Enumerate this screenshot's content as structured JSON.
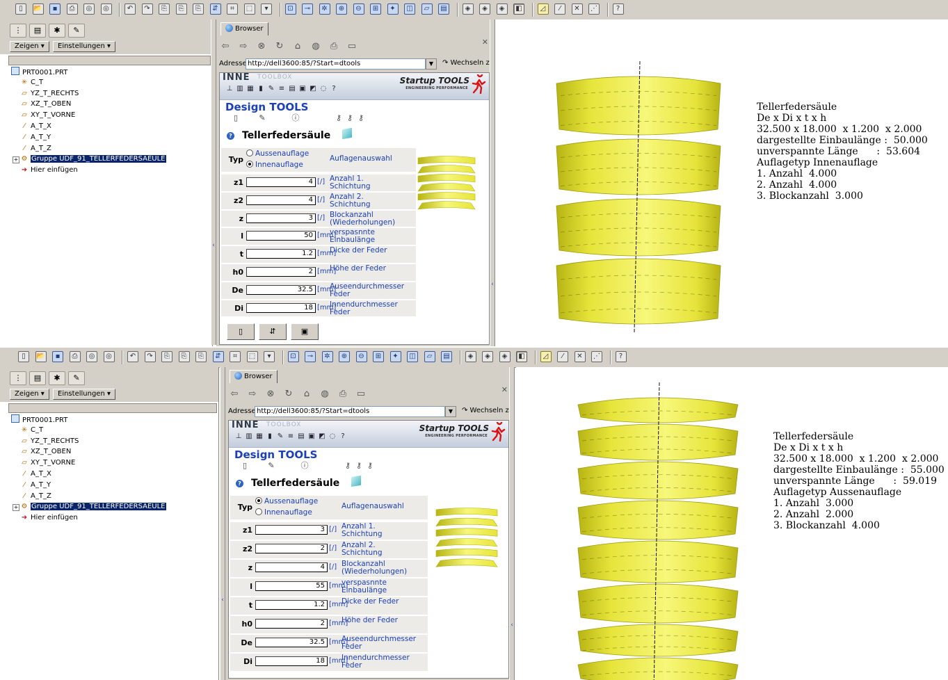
{
  "colors": {
    "spring_light": "#f7f77a",
    "spring_mid": "#e6e43a",
    "spring_dark": "#b7b414",
    "title_blue": "#1b3fb7",
    "selected": "#0a246a"
  },
  "instances": [
    {
      "tree": {
        "menu_show": "Zeigen",
        "menu_settings": "Einstellungen",
        "items": [
          {
            "label": "PRT0001.PRT",
            "icon": "part-icon"
          },
          {
            "label": "C_T",
            "icon": "csys-icon"
          },
          {
            "label": "YZ_T_RECHTS",
            "icon": "datum-plane-icon"
          },
          {
            "label": "XZ_T_OBEN",
            "icon": "datum-plane-icon"
          },
          {
            "label": "XY_T_VORNE",
            "icon": "datum-plane-icon"
          },
          {
            "label": "A_T_X",
            "icon": "datum-axis-icon"
          },
          {
            "label": "A_T_Y",
            "icon": "datum-axis-icon"
          },
          {
            "label": "A_T_Z",
            "icon": "datum-axis-icon"
          },
          {
            "label": "Gruppe UDF_91_TELLERFEDERSAEULE",
            "icon": "group-icon"
          },
          {
            "label": "Hier einfügen",
            "icon": "insert-here-icon"
          }
        ]
      },
      "browser": {
        "tab": "Browser",
        "address_label": "Adresse",
        "address": "http://dell3600:85/?Start=dtools",
        "go": "Wechseln zu",
        "brand_left": "INNE",
        "brand_toolbox": "TOOLBOX",
        "brand_right": "Startup TOOLS",
        "brand_sub": "ENGINEERING PERFORMANCE",
        "design_title": "Design TOOLS",
        "panel_title": "Tellerfedersäule",
        "typ_label": "Typ",
        "radio_outer": "Aussenauflage",
        "radio_inner": "Innenauflage",
        "selected": "inner",
        "typ_desc": "Auflagenauswahl",
        "params": [
          {
            "label": "z1",
            "value": "4",
            "unit": "[/]",
            "desc": "Anzahl 1.\nSchichtung"
          },
          {
            "label": "z2",
            "value": "4",
            "unit": "[/]",
            "desc": "Anzahl 2.\nSchichtung"
          },
          {
            "label": "z",
            "value": "3",
            "unit": "[/]",
            "desc": "Blockanzahl\n(Wiederholungen)"
          },
          {
            "label": "l",
            "value": "50",
            "unit": "[mm]",
            "desc": "verspasnnte\nEinbaulänge"
          },
          {
            "label": "t",
            "value": "1.2",
            "unit": "[mm]",
            "desc": "Dicke der Feder"
          },
          {
            "label": "h0",
            "value": "2",
            "unit": "[mm]",
            "desc": "Höhe der Feder"
          },
          {
            "label": "De",
            "value": "32.5",
            "unit": "[mm]",
            "desc": "Auseendurchmesser\nFeder"
          },
          {
            "label": "Di",
            "value": "18",
            "unit": "[mm]",
            "desc": "Innendurchmesser\nFeder"
          }
        ]
      },
      "info": [
        "Tellerfedersäule",
        "De x Di x t x h",
        "32.500 x 18.000  x 1.200  x 2.000",
        "dargestellte Einbaulänge :  50.000",
        "unverspannte Länge      :  53.604",
        "Auflagetyp Innenauflage",
        "1. Anzahl  4.000",
        "2. Anzahl  4.000",
        "3. Blockanzahl  3.000"
      ]
    },
    {
      "tree": {
        "menu_show": "Zeigen",
        "menu_settings": "Einstellungen",
        "items": [
          {
            "label": "PRT0001.PRT",
            "icon": "part-icon"
          },
          {
            "label": "C_T",
            "icon": "csys-icon"
          },
          {
            "label": "YZ_T_RECHTS",
            "icon": "datum-plane-icon"
          },
          {
            "label": "XZ_T_OBEN",
            "icon": "datum-plane-icon"
          },
          {
            "label": "XY_T_VORNE",
            "icon": "datum-plane-icon"
          },
          {
            "label": "A_T_X",
            "icon": "datum-axis-icon"
          },
          {
            "label": "A_T_Y",
            "icon": "datum-axis-icon"
          },
          {
            "label": "A_T_Z",
            "icon": "datum-axis-icon"
          },
          {
            "label": "Gruppe UDF_91_TELLERFEDERSAEULE",
            "icon": "group-icon"
          },
          {
            "label": "Hier einfügen",
            "icon": "insert-here-icon"
          }
        ]
      },
      "browser": {
        "tab": "Browser",
        "address_label": "Adresse",
        "address": "http://dell3600:85/?Start=dtools",
        "go": "Wechseln zu",
        "brand_left": "INNE",
        "brand_toolbox": "TOOLBOX",
        "brand_right": "Startup TOOLS",
        "brand_sub": "ENGINEERING PERFORMANCE",
        "design_title": "Design TOOLS",
        "panel_title": "Tellerfedersäule",
        "typ_label": "Typ",
        "radio_outer": "Aussenauflage",
        "radio_inner": "Innenauflage",
        "selected": "outer",
        "typ_desc": "Auflagenauswahl",
        "params": [
          {
            "label": "z1",
            "value": "3",
            "unit": "[/]",
            "desc": "Anzahl 1.\nSchichtung"
          },
          {
            "label": "z2",
            "value": "2",
            "unit": "[/]",
            "desc": "Anzahl 2.\nSchichtung"
          },
          {
            "label": "z",
            "value": "4",
            "unit": "[/]",
            "desc": "Blockanzahl\n(Wiederholungen)"
          },
          {
            "label": "l",
            "value": "55",
            "unit": "[mm]",
            "desc": "verspasnnte\nEinbaulänge"
          },
          {
            "label": "t",
            "value": "1.2",
            "unit": "[mm]",
            "desc": "Dicke der Feder"
          },
          {
            "label": "h0",
            "value": "2",
            "unit": "[mm]",
            "desc": "Höhe der Feder"
          },
          {
            "label": "De",
            "value": "32.5",
            "unit": "[mm]",
            "desc": "Auseendurchmesser\nFeder"
          },
          {
            "label": "Di",
            "value": "18",
            "unit": "[mm]",
            "desc": "Innendurchmesser\nFeder"
          }
        ]
      },
      "info": [
        "Tellerfedersäule",
        "De x Di x t x h",
        "32.500 x 18.000  x 1.200  x 2.000",
        "dargestellte Einbaulänge :  55.000",
        "unverspannte Länge      :  59.019",
        "Auflagetyp Aussenauflage",
        "1. Anzahl  3.000",
        "2. Anzahl  2.000",
        "3. Blockanzahl  4.000"
      ]
    }
  ]
}
